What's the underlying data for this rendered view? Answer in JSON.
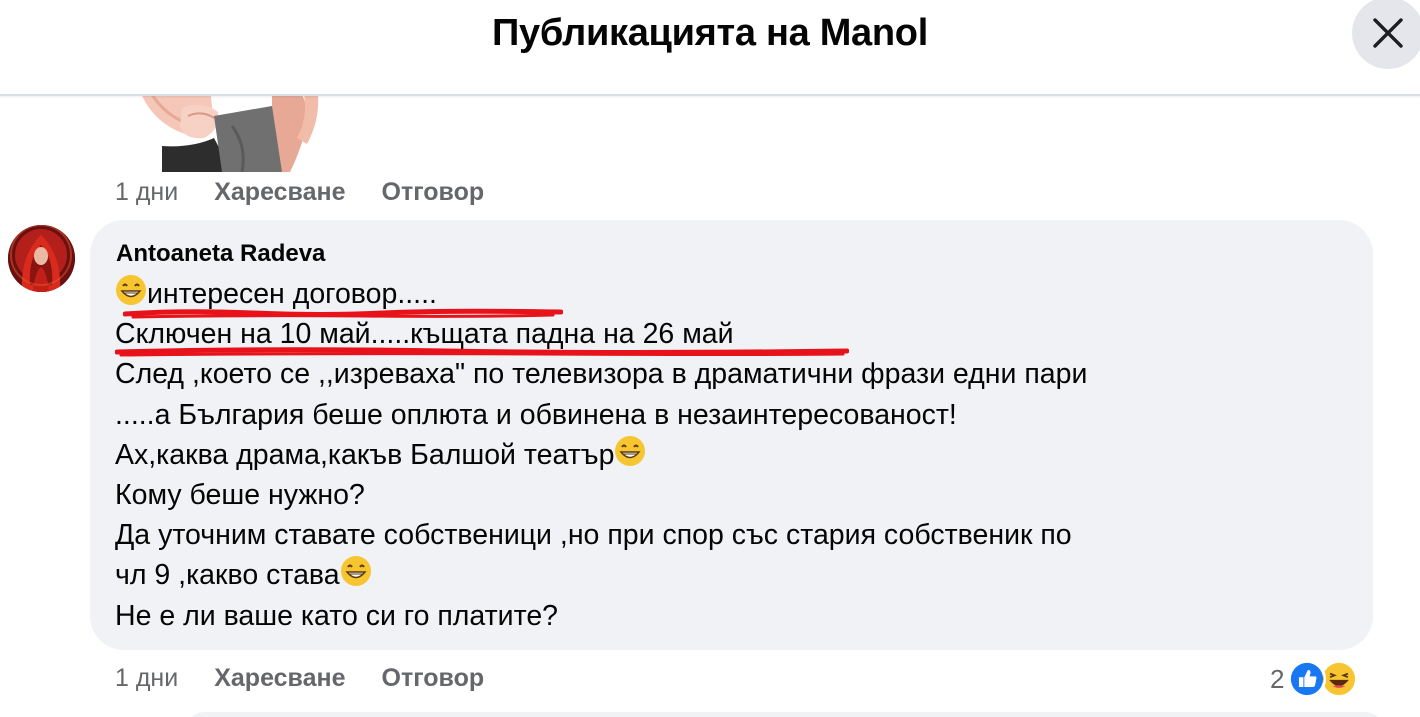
{
  "header": {
    "title": "Публикацията на Manol",
    "close_icon": "close-icon"
  },
  "previous_comment": {
    "meta": {
      "time": "1 дни",
      "like": "Харесване",
      "reply": "Отговор"
    }
  },
  "comment": {
    "author": "Antoaneta Radeva",
    "lines": [
      "интересен договор.....",
      "Сключен на 10 май.....къщата падна на 26 май",
      "След ,което се ,,изреваха\" по телевизора в драматични фрази едни пари",
      ".....а България беше оплюта и обвинена в незаинтересованост!",
      "Ах,каква драма,какъв Балшой театър",
      "Кому беше нужно?",
      "Да уточним ставате собственици ,но при спор със стария собственик по",
      "чл 9 ,какво става",
      "Не е ли ваше като си го платите?"
    ],
    "meta": {
      "time": "1 дни",
      "like": "Харесване",
      "reply": "Отговор"
    },
    "reactions": {
      "count": "2",
      "icons": [
        "like-icon",
        "haha-icon"
      ]
    }
  },
  "colors": {
    "bubble": "#f0f2f5",
    "meta_text": "#65676b",
    "underline": "#e8131a",
    "like_blue": "#1877f2"
  }
}
